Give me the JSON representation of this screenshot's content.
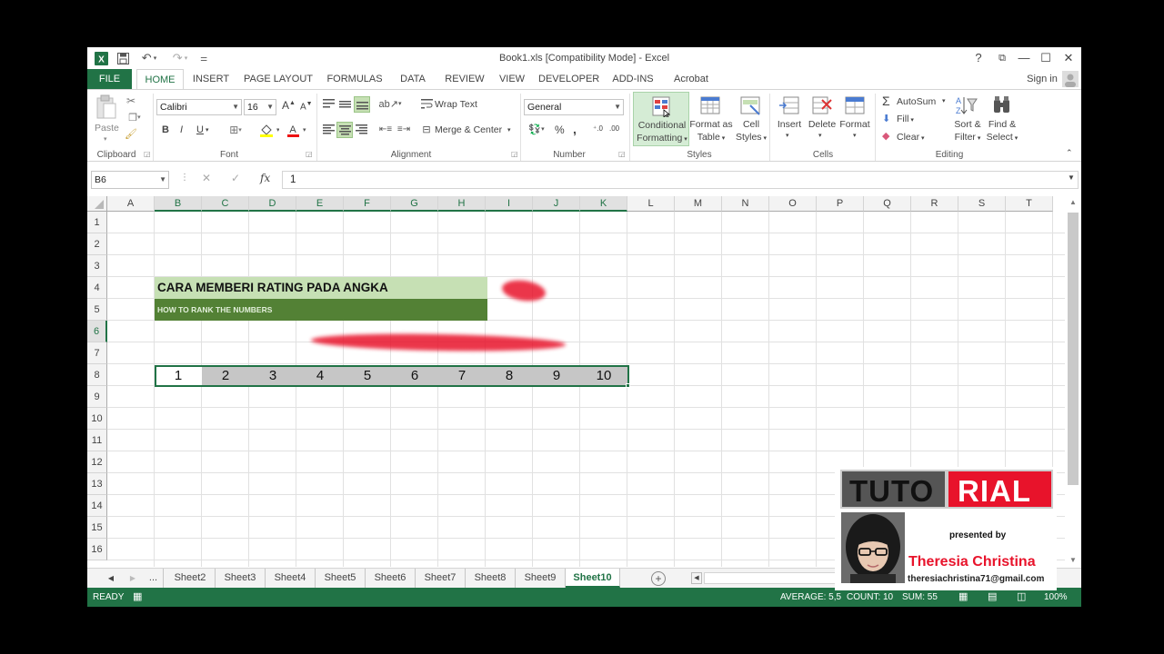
{
  "window": {
    "title": "Book1.xls  [Compatibility Mode] - Excel",
    "sign_in": "Sign in",
    "help": "?"
  },
  "tabs": [
    {
      "label": "FILE"
    },
    {
      "label": "HOME"
    },
    {
      "label": "INSERT"
    },
    {
      "label": "PAGE LAYOUT"
    },
    {
      "label": "FORMULAS"
    },
    {
      "label": "DATA"
    },
    {
      "label": "REVIEW"
    },
    {
      "label": "VIEW"
    },
    {
      "label": "DEVELOPER"
    },
    {
      "label": "ADD-INS"
    },
    {
      "label": "Acrobat"
    }
  ],
  "ribbon": {
    "clipboard": {
      "paste": "Paste",
      "label": "Clipboard"
    },
    "font": {
      "name": "Calibri",
      "size": "16",
      "bold": "B",
      "italic": "I",
      "underline": "U",
      "grow": "A",
      "shrink": "A",
      "label": "Font"
    },
    "alignment": {
      "wrap": "Wrap Text",
      "merge": "Merge & Center",
      "label": "Alignment"
    },
    "number": {
      "format": "General",
      "percent": "%",
      "comma": ",",
      "label": "Number"
    },
    "styles": {
      "cond1": "Conditional",
      "cond2": "Formatting",
      "table1": "Format as",
      "table2": "Table",
      "cell1": "Cell",
      "cell2": "Styles",
      "label": "Styles"
    },
    "cells": {
      "insert": "Insert",
      "delete": "Delete",
      "format": "Format",
      "label": "Cells"
    },
    "editing": {
      "autosum": "AutoSum",
      "fill": "Fill",
      "clear": "Clear",
      "sort1": "Sort &",
      "sort2": "Filter",
      "find1": "Find &",
      "find2": "Select",
      "label": "Editing"
    }
  },
  "formula_bar": {
    "name_box": "B6",
    "fx": "fx",
    "value": "1"
  },
  "columns": [
    "A",
    "B",
    "C",
    "D",
    "E",
    "F",
    "G",
    "H",
    "I",
    "J",
    "K",
    "L",
    "M",
    "N",
    "O",
    "P",
    "Q",
    "R",
    "S",
    "T"
  ],
  "rows": [
    "1",
    "2",
    "3",
    "4",
    "5",
    "6",
    "7",
    "8",
    "9",
    "10",
    "11",
    "12",
    "13",
    "14",
    "15",
    "16"
  ],
  "cells": {
    "title": "CARA MEMBERI RATING PADA ANGKA",
    "subtitle": "HOW TO RANK THE NUMBERS",
    "numbers": [
      "1",
      "2",
      "3",
      "4",
      "5",
      "6",
      "7",
      "8",
      "9",
      "10"
    ]
  },
  "sheets": {
    "more": "...",
    "tabs": [
      "Sheet2",
      "Sheet3",
      "Sheet4",
      "Sheet5",
      "Sheet6",
      "Sheet7",
      "Sheet8",
      "Sheet9",
      "Sheet10"
    ],
    "active": "Sheet10"
  },
  "status": {
    "ready": "READY",
    "average": "AVERAGE: 5,5",
    "count": "COUNT: 10",
    "sum": "SUM: 55",
    "zoom": "100%"
  },
  "tutorial": {
    "logo_left": "TUTO",
    "logo_right": "RIAL",
    "presented": "presented by",
    "name": "Theresia Christina",
    "email": "theresiachristina71@gmail.com"
  },
  "colors": {
    "excel_green": "#217346",
    "title_fill": "#c6e0b4",
    "subtitle_fill": "#538135",
    "selection": "#c6c6c6",
    "tutorial_red": "#e8132b"
  }
}
